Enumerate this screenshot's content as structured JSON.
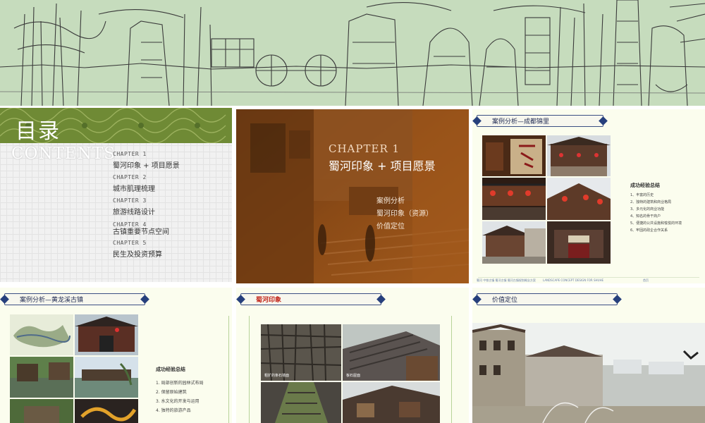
{
  "contents_slide": {
    "title": "目录",
    "subtitle": "CONTENTS",
    "items": [
      {
        "chapter": "CHAPTER 1",
        "name": "蜀河印象 + 项目愿景"
      },
      {
        "chapter": "CHAPTER 2",
        "name": "城市肌理梳理"
      },
      {
        "chapter": "CHAPTER 3",
        "name": "旅游线路设计"
      },
      {
        "chapter": "CHAPTER 4",
        "name": "古镇重要节点空间"
      },
      {
        "chapter": "CHAPTER 5",
        "name": "民生及投资预算"
      }
    ]
  },
  "chapter_slide": {
    "chapter": "CHAPTER 1",
    "title": "蜀河印象 + 项目愿景",
    "items": [
      "案例分析",
      "蜀河印象（资源）",
      "价值定位"
    ]
  },
  "case_chengdu": {
    "tag": "案例分析—成都锦里",
    "summary_title": "成功经验总结",
    "summary_items": [
      "1、丰富的历史",
      "2、独特的建筑和商业格局",
      "3、多元化的商业功能",
      "4、知名的骨干商户",
      "5、便捷的公共设施和愉悦的环境",
      "6、牢固的政企合作关系"
    ],
    "footer_left": "蜀河    中铁古镇    蜀河古镇    蜀河古镇规划概念方案",
    "footer_mid": "LANDSCAPE CONCEPT DESIGN FOR SHUHE",
    "footer_right": "首页"
  },
  "case_huanglongxi": {
    "tag": "案例分析—黄龙溪古镇",
    "summary_title": "成功经验总结",
    "summary_items": [
      "1.    局部创新的园林式布局",
      "2.    保留原始建筑",
      "3.    水文化的开发与运用",
      "4.    独特的旅游产品"
    ]
  },
  "shuhe_impression": {
    "tag": "蜀河印象",
    "captions": [
      "粗犷的条石墙面",
      "板石屋面"
    ]
  },
  "value_positioning": {
    "tag": "价值定位"
  },
  "colors": {
    "banner_bg": "#c6dcbd",
    "green_band": "#6f8a35",
    "chapter_bg": "#8a4a16",
    "card_bg": "#fbfdee",
    "tag_border": "#3b4f83",
    "tag_red": "#c2261b"
  }
}
